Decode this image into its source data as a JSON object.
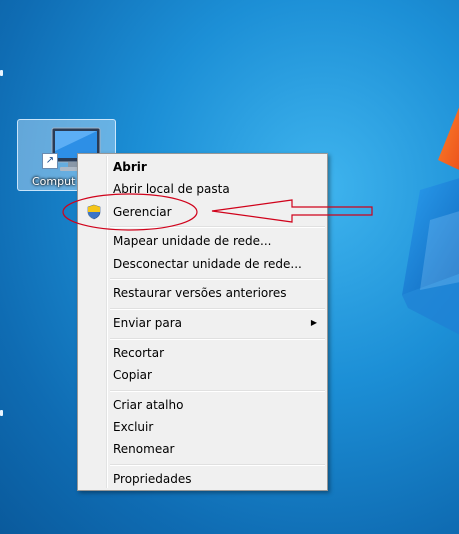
{
  "desktop": {
    "icon_label": "Comput",
    "shortcut_glyph": "↗"
  },
  "menu": {
    "items": [
      {
        "label": "Abrir",
        "bold": true
      },
      {
        "label": "Abrir local de pasta"
      },
      {
        "label": "Gerenciar",
        "icon": "uac-shield-icon"
      },
      {
        "label": "Mapear unidade de rede..."
      },
      {
        "label": "Desconectar unidade de rede..."
      },
      {
        "label": "Restaurar versões anteriores"
      },
      {
        "label": "Enviar para",
        "submenu": true
      },
      {
        "label": "Recortar"
      },
      {
        "label": "Copiar"
      },
      {
        "label": "Criar atalho"
      },
      {
        "label": "Excluir"
      },
      {
        "label": "Renomear"
      },
      {
        "label": "Propriedades"
      }
    ],
    "submenu_arrow": "▶"
  },
  "colors": {
    "desktop_blue": "#1c8fd6",
    "annotation_red": "#d0021b",
    "menu_bg": "#f0f0f0"
  }
}
